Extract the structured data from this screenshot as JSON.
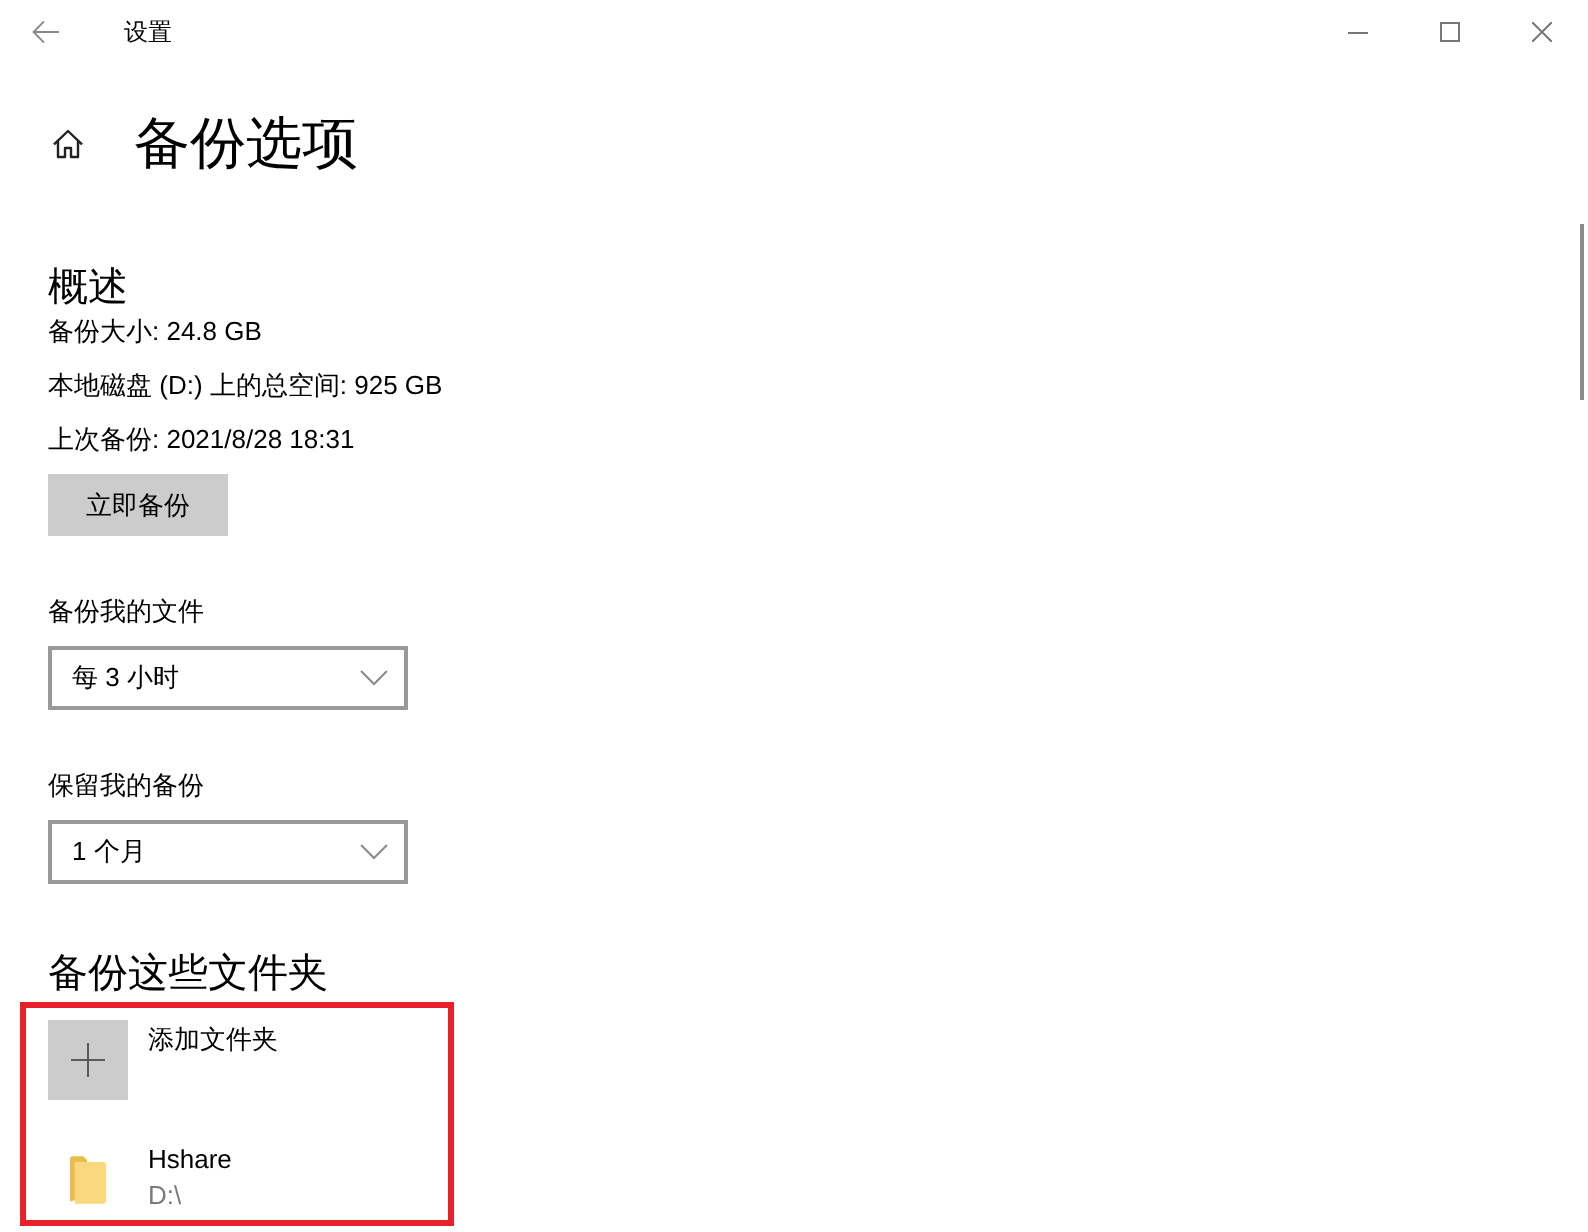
{
  "window": {
    "title": "设置"
  },
  "page": {
    "title": "备份选项"
  },
  "overview": {
    "heading": "概述",
    "lines": [
      "备份大小: 24.8 GB",
      "本地磁盘 (D:) 上的总空间: 925 GB",
      "上次备份: 2021/8/28 18:31"
    ],
    "button": "立即备份"
  },
  "settings": [
    {
      "label": "备份我的文件",
      "value": "每 3 小时"
    },
    {
      "label": "保留我的备份",
      "value": "1 个月"
    }
  ],
  "folders": {
    "heading": "备份这些文件夹",
    "highlighted": true,
    "items": [
      {
        "kind": "add",
        "name": "添加文件夹"
      },
      {
        "kind": "folder",
        "name": "Hshare",
        "path": "D:\\"
      }
    ]
  }
}
